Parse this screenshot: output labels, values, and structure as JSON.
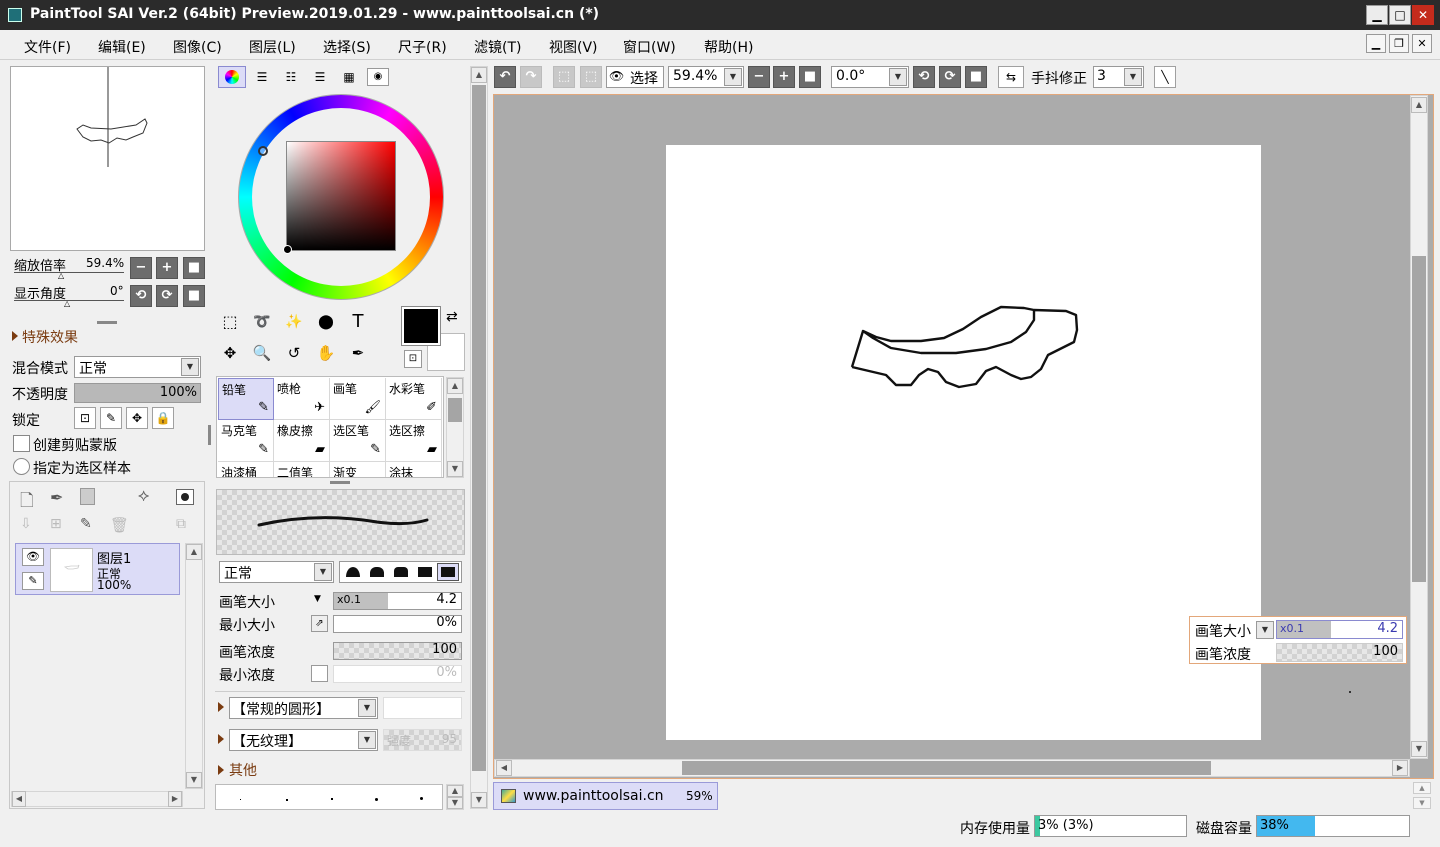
{
  "window": {
    "title": "PaintTool SAI Ver.2 (64bit) Preview.2019.01.29 - www.painttoolsai.cn (*)",
    "minimize": "▁",
    "maximize": "□",
    "close": "✕"
  },
  "menu": [
    "文件(F)",
    "编辑(E)",
    "图像(C)",
    "图层(L)",
    "选择(S)",
    "尺子(R)",
    "滤镜(T)",
    "视图(V)",
    "窗口(W)",
    "帮助(H)"
  ],
  "navigator": {
    "zoom_label": "缩放倍率",
    "zoom_value": "59.4%",
    "angle_label": "显示角度",
    "angle_value": "0°"
  },
  "layer_props": {
    "special_effects": "特殊效果",
    "blend_label": "混合模式",
    "blend_value": "正常",
    "opacity_label": "不透明度",
    "opacity_value": "100%",
    "lock_label": "锁定",
    "clip_label": "创建剪贴蒙版",
    "sample_label": "指定为选区样本"
  },
  "layers": [
    {
      "name": "图层1",
      "mode": "正常",
      "opacity": "100%"
    }
  ],
  "tools": [
    {
      "label": "铅笔",
      "icon": "✎",
      "selected": true
    },
    {
      "label": "喷枪",
      "icon": "✈",
      "selected": false
    },
    {
      "label": "画笔",
      "icon": "🖌",
      "selected": false
    },
    {
      "label": "水彩笔",
      "icon": "✐",
      "selected": false
    },
    {
      "label": "马克笔",
      "icon": "✎",
      "selected": false
    },
    {
      "label": "橡皮擦",
      "icon": "▰",
      "selected": false
    },
    {
      "label": "选区笔",
      "icon": "✎",
      "selected": false
    },
    {
      "label": "选区擦",
      "icon": "▰",
      "selected": false
    },
    {
      "label": "油漆桶",
      "icon": "",
      "selected": false
    },
    {
      "label": "二值笔",
      "icon": "",
      "selected": false
    },
    {
      "label": "渐变",
      "icon": "",
      "selected": false
    },
    {
      "label": "涂抹",
      "icon": "",
      "selected": false
    }
  ],
  "brush": {
    "mode_value": "正常",
    "size_label": "画笔大小",
    "size_mult": "x0.1",
    "size_value": "4.2",
    "min_size_label": "最小大小",
    "min_size_value": "0%",
    "density_label": "画笔浓度",
    "density_value": "100",
    "min_density_label": "最小浓度",
    "min_density_value": "0%",
    "shape_value": "【常规的圆形】",
    "texture_value": "【无纹理】",
    "strength_label": "强度",
    "strength_value": "95",
    "other_label": "其他"
  },
  "toolbar": {
    "select_label": "选择",
    "zoom_value": "59.4%",
    "angle_value": "0.0°",
    "stabilizer_label": "手抖修正",
    "stabilizer_value": "3"
  },
  "hud": {
    "size_label": "画笔大小",
    "size_mult": "x0.1",
    "size_value": "4.2",
    "density_label": "画笔浓度",
    "density_value": "100"
  },
  "doc_tab": {
    "name": "www.painttoolsai.cn",
    "zoom": "59%"
  },
  "status": {
    "memory_label": "内存使用量",
    "memory_value": "3% (3%)",
    "memory_fraction": 0.03,
    "disk_label": "磁盘容量",
    "disk_value": "38%",
    "disk_fraction": 0.38
  },
  "colors": {
    "accent": "#dcdcf7",
    "primary_color": "#000000",
    "secondary_color": "#ffffff",
    "canvas_bg": "#ababab",
    "disk_bar": "#43b8ef",
    "memory_bar": "#3cc8a0"
  }
}
